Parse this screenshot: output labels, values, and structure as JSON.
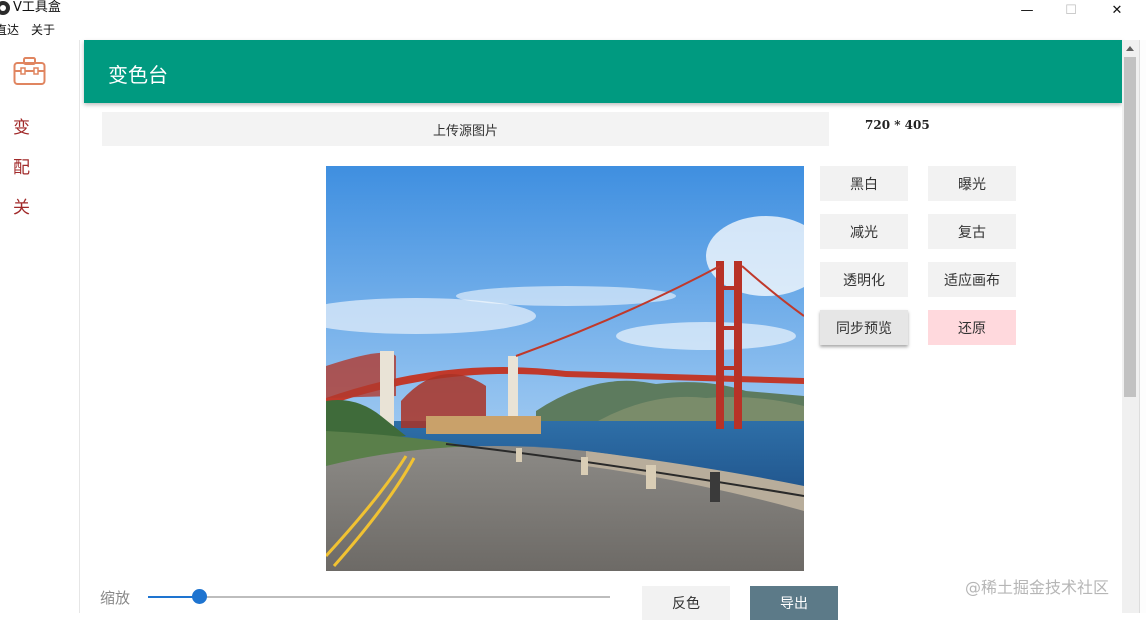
{
  "window": {
    "title": "V工具盒",
    "min_glyph": "—",
    "max_glyph": "☐",
    "close_glyph": "✕"
  },
  "menu": {
    "items": [
      "直达",
      "关于"
    ]
  },
  "nav": {
    "items": [
      "变",
      "配",
      "关"
    ]
  },
  "header": {
    "title": "变色台"
  },
  "upload": {
    "label": "上传源图片",
    "dimensions": "720 * 405"
  },
  "effects": {
    "grayscale": "黑白",
    "exposure": "曝光",
    "dim": "减光",
    "vintage": "复古",
    "transparent": "透明化",
    "fit_canvas": "适应画布",
    "sync_preview": "同步预览",
    "restore": "还原"
  },
  "zoom": {
    "label": "缩放",
    "value": 0.11
  },
  "actions": {
    "invert": "反色",
    "export": "导出"
  },
  "watermark": "@稀土掘金技术社区",
  "colors": {
    "header": "#009a80",
    "accent": "#1e74d0",
    "restore_bg": "#ffd9dd",
    "export_bg": "#5c7a88",
    "nav_text": "#a12a2a"
  }
}
